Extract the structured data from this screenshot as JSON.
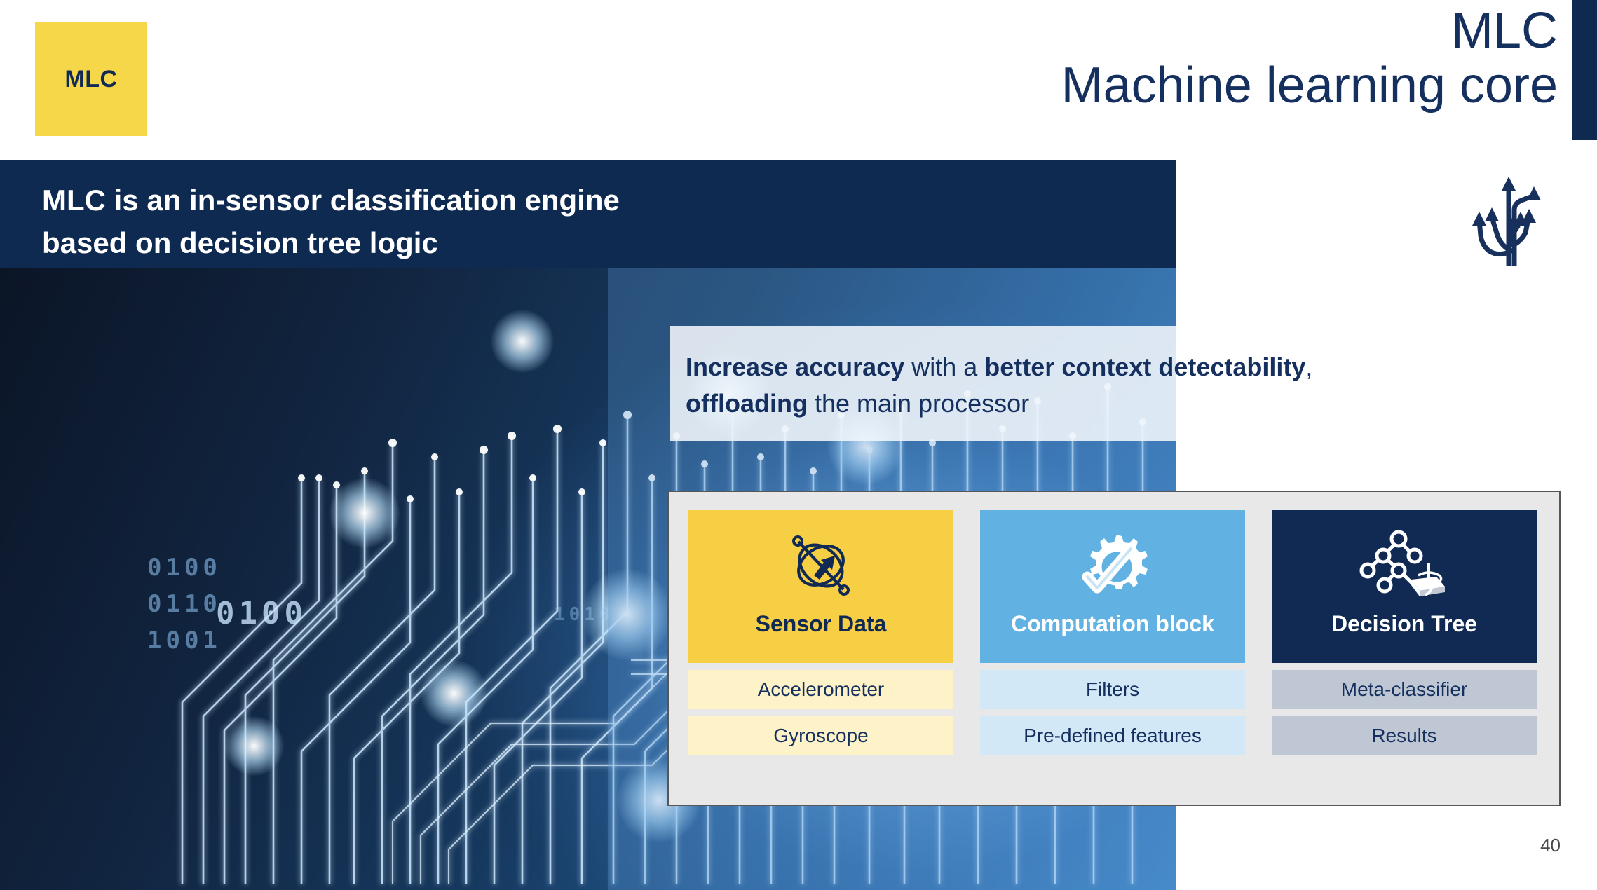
{
  "header": {
    "badge_label": "MLC",
    "title_line1": "MLC",
    "title_line2": "Machine learning core",
    "tree_arrows_icon": "branching-arrows-icon"
  },
  "banner": {
    "text": "MLC is an in-sensor classification engine\nbased on decision tree logic"
  },
  "statement": {
    "part1_bold": "Increase accuracy",
    "part2": " with a ",
    "part3_bold": "better context detectability",
    "part4": ", ",
    "part5_bold": "offloading",
    "part6": " the main processor"
  },
  "background": {
    "binary_digits": [
      "0100",
      "0110",
      "1001",
      "0100",
      "1010"
    ]
  },
  "panel": {
    "columns": [
      {
        "title": "Sensor Data",
        "icon": "sensor-orbital-icon",
        "theme": "yellow",
        "rows": [
          "Accelerometer",
          "Gyroscope"
        ]
      },
      {
        "title": "Computation block",
        "icon": "gear-check-icon",
        "theme": "blue",
        "rows": [
          "Filters",
          "Pre-defined features"
        ]
      },
      {
        "title": "Decision Tree",
        "icon": "decision-tree-chip-icon",
        "theme": "navy",
        "rows": [
          "Meta-classifier",
          "Results"
        ]
      }
    ]
  },
  "footer": {
    "page_number": "40"
  },
  "colors": {
    "brand_navy": "#102a54",
    "brand_yellow": "#f7d74a",
    "brand_blue": "#62b1e3",
    "panel_bg": "#e8e8e8"
  }
}
